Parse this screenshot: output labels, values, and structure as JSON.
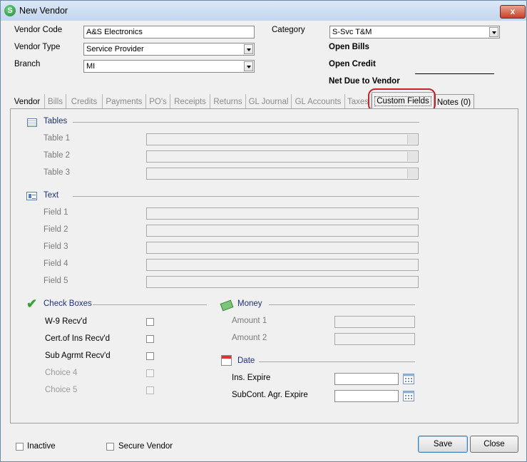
{
  "window": {
    "title": "New Vendor",
    "app_icon_letter": "S",
    "close_glyph": "x"
  },
  "header": {
    "vendor_code_label": "Vendor Code",
    "vendor_code_value": "A&S Electronics",
    "vendor_type_label": "Vendor Type",
    "vendor_type_value": "Service Provider",
    "branch_label": "Branch",
    "branch_value": "MI",
    "category_label": "Category",
    "category_value": "S-Svc T&M",
    "open_bills_label": "Open Bills",
    "open_credit_label": "Open Credit",
    "net_due_label": "Net Due to Vendor"
  },
  "tabs": [
    {
      "label": "Vendor"
    },
    {
      "label": "Bills"
    },
    {
      "label": "Credits"
    },
    {
      "label": "Payments"
    },
    {
      "label": "PO's"
    },
    {
      "label": "Receipts"
    },
    {
      "label": "Returns"
    },
    {
      "label": "GL Journal"
    },
    {
      "label": "GL Accounts"
    },
    {
      "label": "Taxes"
    },
    {
      "label": "Custom Fields"
    },
    {
      "label": "Notes (0)"
    }
  ],
  "active_tab": "Custom Fields",
  "sections": {
    "tables": {
      "title": "Tables",
      "fields": [
        "Table 1",
        "Table 2",
        "Table 3"
      ]
    },
    "text": {
      "title": "Text",
      "fields": [
        "Field 1",
        "Field 2",
        "Field 3",
        "Field 4",
        "Field 5"
      ]
    },
    "check_boxes": {
      "title": "Check Boxes",
      "items": [
        "W-9 Recv'd",
        "Cert.of Ins Recv'd",
        "Sub Agrmt Recv'd",
        "Choice 4",
        "Choice 5"
      ]
    },
    "money": {
      "title": "Money",
      "fields": [
        "Amount 1",
        "Amount 2"
      ]
    },
    "date": {
      "title": "Date",
      "fields": [
        "Ins. Expire",
        "SubCont. Agr. Expire"
      ]
    }
  },
  "footer": {
    "inactive_label": "Inactive",
    "secure_vendor_label": "Secure Vendor",
    "save_label": "Save",
    "close_label": "Close"
  },
  "colors": {
    "section_title": "#1e2f78",
    "highlight_ring": "#c0262b",
    "disabled_text": "#7a7a7a"
  }
}
